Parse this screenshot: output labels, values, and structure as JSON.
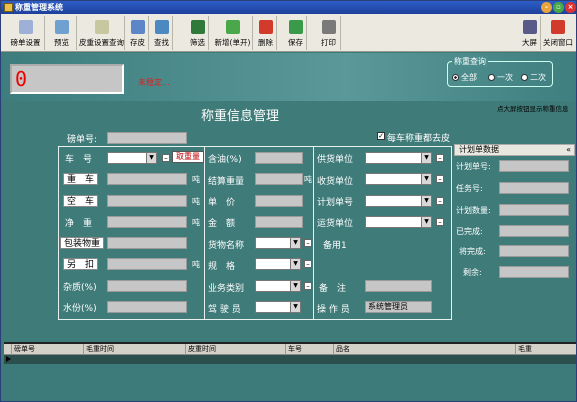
{
  "window": {
    "title": "称重管理系统"
  },
  "toolbar": {
    "weigh_settings": "磅单设置",
    "preview": "预览",
    "tare_query": "皮重设置查询",
    "inventory": "存皮",
    "find": "查找",
    "filter": "筛选",
    "add": "新增(单开)",
    "delete": "删除",
    "save": "保存",
    "print": "打印",
    "fullscreen": "大屏",
    "close_window": "关闭窗口"
  },
  "header": {
    "weight_display": "0",
    "status_text": "未稳定...",
    "weigh_query": {
      "title": "称重查询",
      "options": [
        "全部",
        "一次",
        "二次"
      ],
      "selected": "全部"
    }
  },
  "hint": "点大屏按钮显示称重信息",
  "form": {
    "title": "称重信息管理",
    "slip_no_label": "磅单号:",
    "auto_clear_label": "每车称重都去皮",
    "left_labels": [
      "车　号",
      "重　车",
      "空　车",
      "净　重",
      "包装物重",
      "另　扣",
      "杂质(%)",
      "水份(%)"
    ],
    "weigh_button": "取重量",
    "unit_ton": "吨",
    "mid_labels": [
      "含油(%)",
      "结算重量",
      "单　价",
      "金　额",
      "货物名称",
      "规　格",
      "业务类别",
      "驾 驶 员"
    ],
    "right_labels": [
      "供货单位",
      "收货单位",
      "计划单号",
      "运货单位",
      "备用1",
      "备　注",
      "操 作 员"
    ],
    "operator_value": "系统管理员"
  },
  "plan_panel": {
    "title": "计划单数据",
    "fields": [
      "计划单号:",
      "任务号:",
      "计划数量:",
      "已完成:",
      "将完成:",
      "剩余:"
    ]
  },
  "table": {
    "columns": [
      "磅单号",
      "毛重时间",
      "皮重时间",
      "车号",
      "品名",
      "毛重",
      ""
    ]
  }
}
